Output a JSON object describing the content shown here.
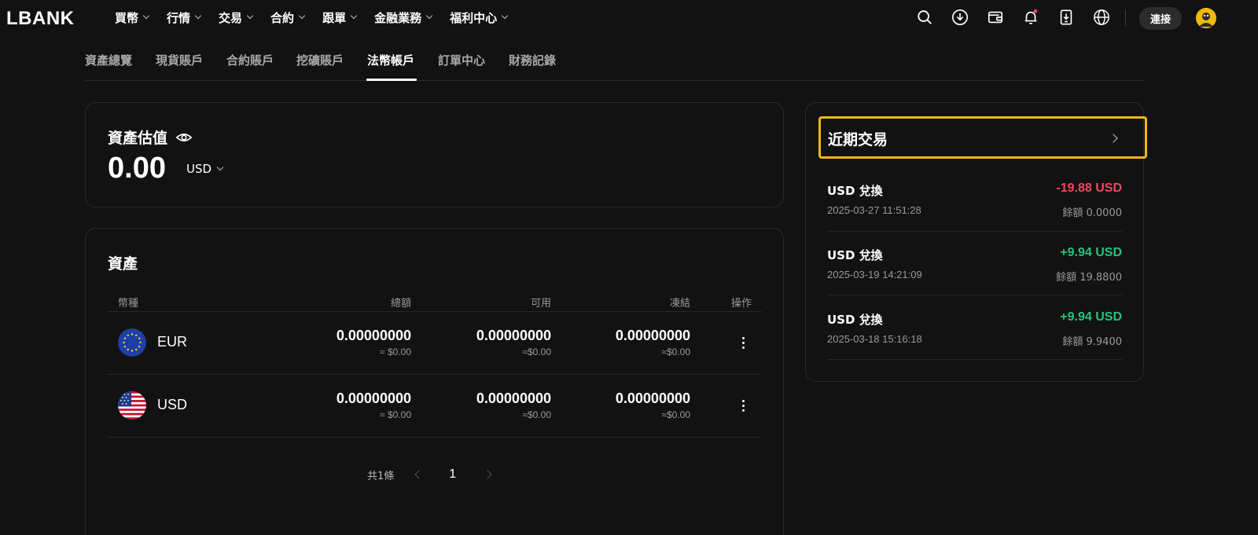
{
  "brand": {
    "logo": "LBANK",
    "accent": "#f0b90b"
  },
  "nav": {
    "items": [
      {
        "label": "買幣"
      },
      {
        "label": "行情"
      },
      {
        "label": "交易"
      },
      {
        "label": "合約"
      },
      {
        "label": "跟單"
      },
      {
        "label": "金融業務"
      },
      {
        "label": "福利中心"
      }
    ],
    "connect_label": "連接",
    "icons": [
      "search-icon",
      "download-icon",
      "wallet-icon",
      "bell-icon",
      "app-download-icon",
      "globe-icon"
    ]
  },
  "tabs": [
    {
      "label": "資產總覽"
    },
    {
      "label": "現貨賬戶"
    },
    {
      "label": "合約賬戶"
    },
    {
      "label": "挖礦賬戶"
    },
    {
      "label": "法幣帳戶",
      "active": true
    },
    {
      "label": "訂單中心"
    },
    {
      "label": "財務記錄"
    }
  ],
  "valuation": {
    "title": "資產估值",
    "amount": "0.00",
    "currency": "USD"
  },
  "assets": {
    "title": "資產",
    "columns": [
      "幣種",
      "總額",
      "可用",
      "凍結",
      "操作"
    ],
    "rows": [
      {
        "coin": "EUR",
        "total": "0.00000000",
        "total_usd": "≈ $0.00",
        "available": "0.00000000",
        "available_usd": "≈$0.00",
        "frozen": "0.00000000",
        "frozen_usd": "≈$0.00"
      },
      {
        "coin": "USD",
        "total": "0.00000000",
        "total_usd": "≈ $0.00",
        "available": "0.00000000",
        "available_usd": "≈$0.00",
        "frozen": "0.00000000",
        "frozen_usd": "≈$0.00"
      }
    ],
    "pager": {
      "total": "共1條",
      "page": "1"
    }
  },
  "recent": {
    "title": "近期交易",
    "transactions": [
      {
        "name": "USD 兌換",
        "time": "2025-03-27 11:51:28",
        "amount": "-19.88 USD",
        "balance": "餘額 0.0000",
        "direction": "neg"
      },
      {
        "name": "USD 兌換",
        "time": "2025-03-19 14:21:09",
        "amount": "+9.94 USD",
        "balance": "餘額 19.8800",
        "direction": "pos"
      },
      {
        "name": "USD 兌換",
        "time": "2025-03-18 15:16:18",
        "amount": "+9.94 USD",
        "balance": "餘額 9.9400",
        "direction": "pos"
      }
    ]
  }
}
